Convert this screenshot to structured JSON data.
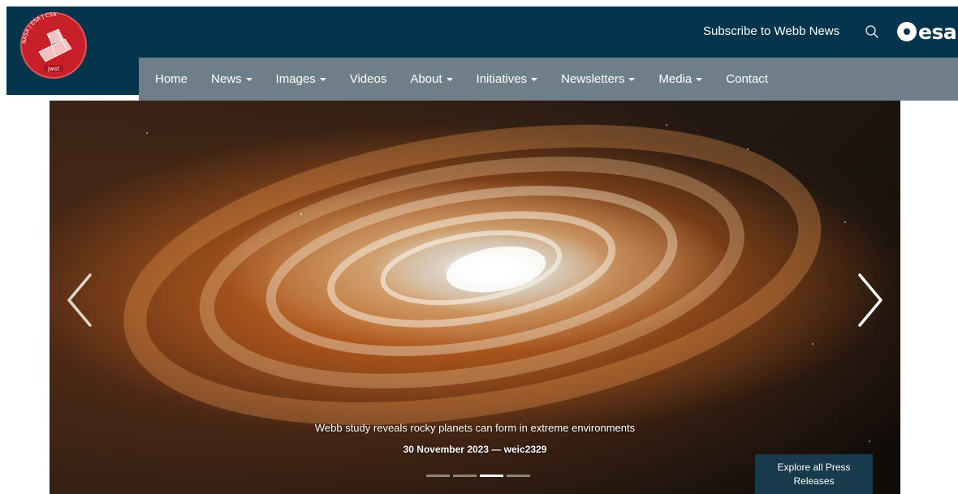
{
  "header": {
    "subscribe_label": "Subscribe to Webb News",
    "logo_arc_text": "NASA | ESA | CSA",
    "logo_badge_text": "jwst",
    "esa_logo_text": "esa",
    "search_icon": "search-icon"
  },
  "nav": {
    "items": [
      {
        "label": "Home",
        "dropdown": false
      },
      {
        "label": "News",
        "dropdown": true
      },
      {
        "label": "Images",
        "dropdown": true
      },
      {
        "label": "Videos",
        "dropdown": false
      },
      {
        "label": "About",
        "dropdown": true
      },
      {
        "label": "Initiatives",
        "dropdown": true
      },
      {
        "label": "Newsletters",
        "dropdown": true
      },
      {
        "label": "Media",
        "dropdown": true
      },
      {
        "label": "Contact",
        "dropdown": false
      }
    ]
  },
  "hero": {
    "title": "Webb study reveals rocky planets can form in extreme environments",
    "date_line": "30 November 2023 — weic2329",
    "explore_label": "Explore all Press Releases",
    "slide_count": 4,
    "active_slide": 3,
    "prev_icon": "chevron-left-icon",
    "next_icon": "chevron-right-icon"
  },
  "colors": {
    "header_bg": "#05354d",
    "navbar_bg": "#6f7f8a",
    "logo_red": "#c8202a",
    "explore_bg": "#173a4d"
  }
}
